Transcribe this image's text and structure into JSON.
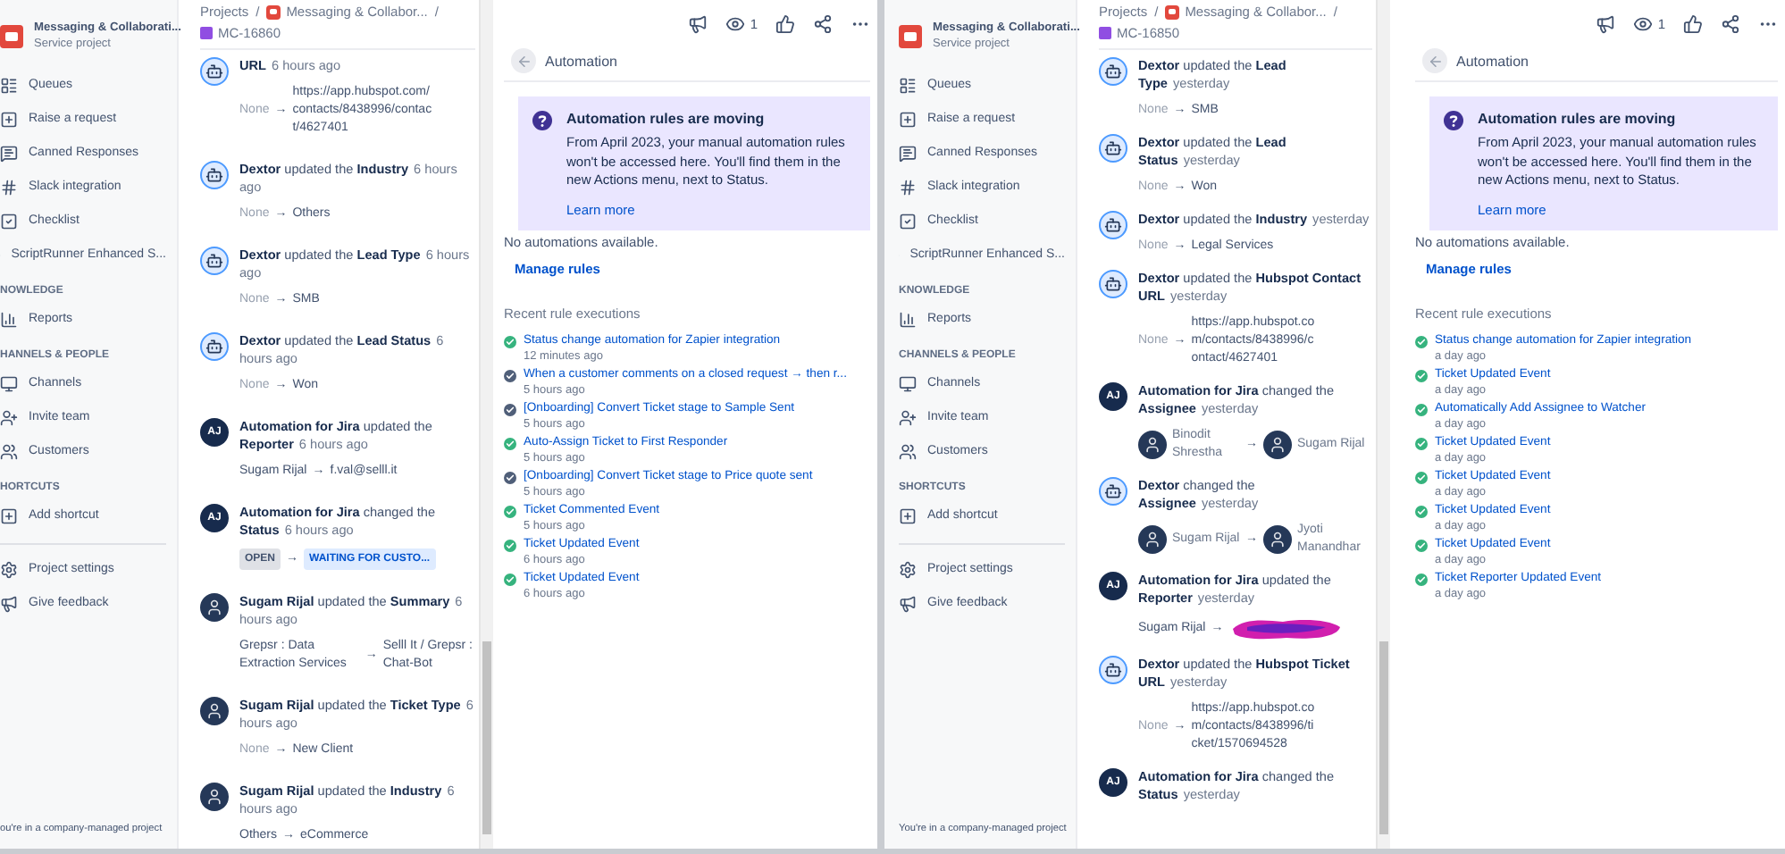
{
  "panes": [
    {
      "sidebar": {
        "project": {
          "name": "Messaging & Collaborati...",
          "type": "Service project"
        },
        "groups": [
          {
            "items": [
              "Queues",
              "Raise a request",
              "Canned Responses",
              "Slack integration",
              "Checklist",
              "ScriptRunner Enhanced S..."
            ]
          },
          {
            "heading": "NOWLEDGE",
            "items": [
              "Reports"
            ]
          },
          {
            "heading": "HANNELS & PEOPLE",
            "items": [
              "Channels",
              "Invite team",
              "Customers"
            ]
          },
          {
            "heading": "HORTCUTS",
            "items": [
              "Add shortcut"
            ]
          },
          {
            "items": [
              "Project settings",
              "Give feedback"
            ]
          }
        ],
        "footer": "ou're in a company-managed project"
      },
      "breadcrumb": {
        "root": "Projects",
        "separator": "/",
        "project": "Messaging & Collabor...",
        "issue": "MC-16860"
      },
      "activity": [
        {
          "kind": "bot",
          "field": "URL",
          "time": "6 hours ago",
          "change": {
            "kind": "text",
            "from": "None",
            "arrow": "→",
            "to": "https://app.hubspot.com/contacts/8438996/contact/4627401"
          }
        },
        {
          "kind": "bot",
          "actor": "Dextor",
          "verb": "updated the",
          "field": "Industry",
          "time": "6 hours ago",
          "change": {
            "kind": "text",
            "from": "None",
            "arrow": "→",
            "to": "Others"
          }
        },
        {
          "kind": "bot",
          "actor": "Dextor",
          "verb": "updated the",
          "field": "Lead Type",
          "time": "6 hours ago",
          "change": {
            "kind": "text",
            "from": "None",
            "arrow": "→",
            "to": "SMB"
          }
        },
        {
          "kind": "bot",
          "actor": "Dextor",
          "verb": "updated the",
          "field": "Lead Status",
          "time": "6 hours ago",
          "change": {
            "kind": "text",
            "from": "None",
            "arrow": "→",
            "to": "Won"
          }
        },
        {
          "kind": "initials",
          "initials": "AJ",
          "actor": "Automation for Jira",
          "verb": "updated the",
          "field": "Reporter",
          "time": "6 hours ago",
          "change": {
            "kind": "text",
            "from": "Sugam Rijal",
            "arrow": "→",
            "to": "f.val@selll.it"
          }
        },
        {
          "kind": "initials",
          "initials": "AJ",
          "actor": "Automation for Jira",
          "verb": "changed the",
          "field": "Status",
          "time": "6 hours ago",
          "change": {
            "kind": "status",
            "from": "OPEN",
            "arrow": "→",
            "to": "WAITING FOR CUSTO..."
          }
        },
        {
          "kind": "person",
          "actor": "Sugam Rijal",
          "verb": "updated the",
          "field": "Summary",
          "time": "6 hours ago",
          "change": {
            "kind": "text",
            "from": "Grepsr : Data Extraction Services",
            "arrow": "→",
            "to": "Selll It / Grepsr : Chat-Bot"
          }
        },
        {
          "kind": "person",
          "actor": "Sugam Rijal",
          "verb": "updated the",
          "field": "Ticket Type",
          "time": "6 hours ago",
          "change": {
            "kind": "text",
            "from": "None",
            "arrow": "→",
            "to": "New Client"
          }
        },
        {
          "kind": "person",
          "actor": "Sugam Rijal",
          "verb": "updated the",
          "field": "Industry",
          "time": "6 hours ago",
          "change": {
            "kind": "text",
            "from": "Others",
            "arrow": "→",
            "to": "eCommerce"
          }
        }
      ],
      "toolbar": {
        "watchers": "1"
      },
      "automation": {
        "title": "Automation",
        "banner": {
          "title": "Automation rules are moving",
          "body": "From April 2023, your manual automation rules won't be accessed here. You'll find them in the new Actions menu, next to Status.",
          "link": "Learn more"
        },
        "empty": "No automations available.",
        "manage": "Manage rules",
        "recent_heading": "Recent rule executions",
        "executions": [
          {
            "title": "Status change automation for Zapier integration",
            "time": "12 minutes ago",
            "color": "#36b37e"
          },
          {
            "title": "When a customer comments on a closed request → then r...",
            "time": "5 hours ago",
            "color": "#505f79"
          },
          {
            "title": "[Onboarding] Convert Ticket stage to Sample Sent",
            "time": "5 hours ago",
            "color": "#505f79"
          },
          {
            "title": "Auto-Assign Ticket to First Responder",
            "time": "5 hours ago",
            "color": "#36b37e"
          },
          {
            "title": "[Onboarding] Convert Ticket stage to Price quote sent",
            "time": "5 hours ago",
            "color": "#505f79"
          },
          {
            "title": "Ticket Commented Event",
            "time": "5 hours ago",
            "color": "#36b37e"
          },
          {
            "title": "Ticket Updated Event",
            "time": "6 hours ago",
            "color": "#36b37e"
          },
          {
            "title": "Ticket Updated Event",
            "time": "6 hours ago",
            "color": "#36b37e"
          }
        ]
      }
    },
    {
      "sidebar": {
        "project": {
          "name": "Messaging & Collaborati...",
          "type": "Service project"
        },
        "groups": [
          {
            "items": [
              "Queues",
              "Raise a request",
              "Canned Responses",
              "Slack integration",
              "Checklist",
              "ScriptRunner Enhanced S..."
            ]
          },
          {
            "heading": "KNOWLEDGE",
            "items": [
              "Reports"
            ]
          },
          {
            "heading": "CHANNELS & PEOPLE",
            "items": [
              "Channels",
              "Invite team",
              "Customers"
            ]
          },
          {
            "heading": "SHORTCUTS",
            "items": [
              "Add shortcut"
            ]
          },
          {
            "items": [
              "Project settings",
              "Give feedback"
            ]
          }
        ],
        "footer": "You're in a company-managed project"
      },
      "breadcrumb": {
        "root": "Projects",
        "separator": "/",
        "project": "Messaging & Collabor...",
        "issue": "MC-16850"
      },
      "activity": [
        {
          "kind": "bot",
          "actor": "Dextor",
          "verb": "updated the",
          "field": "Lead Type",
          "time": "yesterday",
          "change": {
            "kind": "text",
            "from": "None",
            "arrow": "→",
            "to": "SMB"
          }
        },
        {
          "kind": "bot",
          "actor": "Dextor",
          "verb": "updated the",
          "field": "Lead Status",
          "time": "yesterday",
          "change": {
            "kind": "text",
            "from": "None",
            "arrow": "→",
            "to": "Won"
          }
        },
        {
          "kind": "bot",
          "actor": "Dextor",
          "verb": "updated the",
          "field": "Industry",
          "time": "yesterday",
          "change": {
            "kind": "text",
            "from": "None",
            "arrow": "→",
            "to": "Legal Services"
          }
        },
        {
          "kind": "bot",
          "actor": "Dextor",
          "verb": "updated the",
          "field": "Hubspot Contact URL",
          "time": "yesterday",
          "change": {
            "kind": "text",
            "from": "None",
            "arrow": "→",
            "to": "https://app.hubspot.com/contacts/8438996/contact/4627401"
          }
        },
        {
          "kind": "initials",
          "initials": "AJ",
          "actor": "Automation for Jira",
          "verb": "changed the",
          "field": "Assignee",
          "time": "yesterday",
          "change": {
            "kind": "people",
            "from": "Binodit Shrestha",
            "arrow": "→",
            "to": "Sugam Rijal"
          }
        },
        {
          "kind": "bot",
          "actor": "Dextor",
          "verb": "changed the",
          "field": "Assignee",
          "time": "yesterday",
          "change": {
            "kind": "people",
            "from": "Sugam Rijal",
            "arrow": "→",
            "to": "Jyoti Manandhar"
          }
        },
        {
          "kind": "initials",
          "initials": "AJ",
          "actor": "Automation for Jira",
          "verb": "updated the",
          "field": "Reporter",
          "time": "yesterday",
          "change": {
            "kind": "redacted",
            "from": "Sugam Rijal",
            "arrow": "→"
          }
        },
        {
          "kind": "bot",
          "actor": "Dextor",
          "verb": "updated the",
          "field": "Hubspot Ticket URL",
          "time": "yesterday",
          "change": {
            "kind": "text",
            "from": "None",
            "arrow": "→",
            "to": "https://app.hubspot.com/contacts/8438996/ticket/1570694528"
          }
        },
        {
          "kind": "initials",
          "initials": "AJ",
          "actor": "Automation for Jira",
          "verb": "changed the",
          "field": "Status",
          "time": "yesterday"
        }
      ],
      "toolbar": {
        "watchers": "1"
      },
      "automation": {
        "title": "Automation",
        "banner": {
          "title": "Automation rules are moving",
          "body": "From April 2023, your manual automation rules won't be accessed here. You'll find them in the new Actions menu, next to Status.",
          "link": "Learn more"
        },
        "empty": "No automations available.",
        "manage": "Manage rules",
        "recent_heading": "Recent rule executions",
        "executions": [
          {
            "title": "Status change automation for Zapier integration",
            "time": "a day ago",
            "color": "#36b37e"
          },
          {
            "title": "Ticket Updated Event",
            "time": "a day ago",
            "color": "#36b37e"
          },
          {
            "title": "Automatically Add Assignee to Watcher",
            "time": "a day ago",
            "color": "#36b37e"
          },
          {
            "title": "Ticket Updated Event",
            "time": "a day ago",
            "color": "#36b37e"
          },
          {
            "title": "Ticket Updated Event",
            "time": "a day ago",
            "color": "#36b37e"
          },
          {
            "title": "Ticket Updated Event",
            "time": "a day ago",
            "color": "#36b37e"
          },
          {
            "title": "Ticket Updated Event",
            "time": "a day ago",
            "color": "#36b37e"
          },
          {
            "title": "Ticket Reporter Updated Event",
            "time": "a day ago",
            "color": "#36b37e"
          }
        ]
      }
    }
  ]
}
